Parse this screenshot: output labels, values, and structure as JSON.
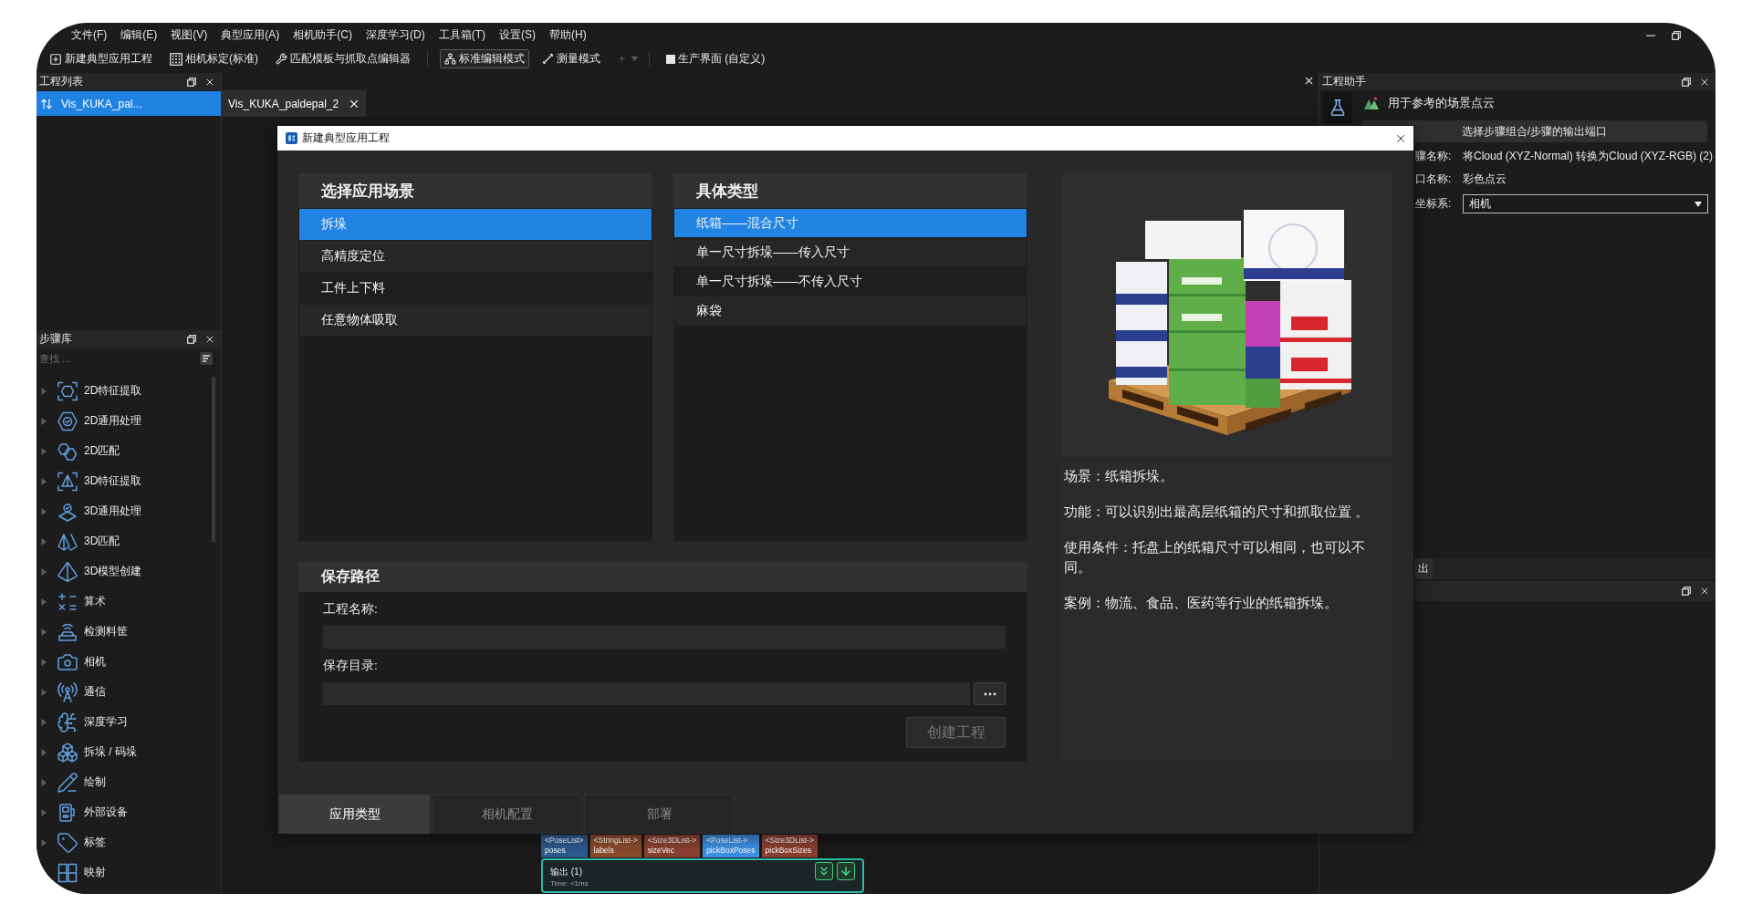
{
  "menubar": {
    "items": [
      "文件(F)",
      "编辑(E)",
      "视图(V)",
      "典型应用(A)",
      "相机助手(C)",
      "深度学习(D)",
      "工具箱(T)",
      "设置(S)",
      "帮助(H)"
    ]
  },
  "toolbar": {
    "actions": [
      {
        "label": "新建典型应用工程"
      },
      {
        "label": "相机标定(标准)"
      },
      {
        "label": "匹配模板与抓取点编辑器"
      }
    ],
    "modes": [
      {
        "label": "标准编辑模式",
        "selected": true
      },
      {
        "label": "测量模式",
        "selected": false
      }
    ],
    "add_menu": {
      "disabled": true
    },
    "views": [
      {
        "label": "生产界面 (自定义)"
      }
    ]
  },
  "project_list": {
    "title": "工程列表",
    "items": [
      {
        "label": "Vis_KUKA_pal...",
        "selected": true
      }
    ]
  },
  "step_library": {
    "title": "步骤库",
    "search": {
      "placeholder": "查找 ..."
    },
    "items": [
      {
        "label": "2D特征提取",
        "expanded": false
      },
      {
        "label": "2D通用处理",
        "expanded": false
      },
      {
        "label": "2D匹配",
        "expanded": false
      },
      {
        "label": "3D特征提取",
        "expanded": false
      },
      {
        "label": "3D通用处理",
        "expanded": false
      },
      {
        "label": "3D匹配",
        "expanded": false
      },
      {
        "label": "3D模型创建",
        "expanded": false
      },
      {
        "label": "算术",
        "expanded": false
      },
      {
        "label": "检测料筐",
        "expanded": false
      },
      {
        "label": "相机",
        "expanded": false
      },
      {
        "label": "通信",
        "expanded": false
      },
      {
        "label": "深度学习",
        "expanded": false
      },
      {
        "label": "拆垛 / 码垛",
        "expanded": false
      },
      {
        "label": "绘制",
        "expanded": false
      },
      {
        "label": "外部设备",
        "expanded": false
      },
      {
        "label": "标签",
        "expanded": false
      },
      {
        "label": "映射",
        "expanded": false
      }
    ]
  },
  "editor": {
    "tabs": [
      {
        "label": "Vis_KUKA_paldepal_2",
        "selected": true
      }
    ],
    "node": {
      "ports": [
        {
          "type": "<PoseList>",
          "name": "poses",
          "color": "#2d5b8e"
        },
        {
          "type": "<StringList->",
          "name": "labels",
          "color": "#8c4b2c"
        },
        {
          "type": "<Size3DList->",
          "name": "sizeVec",
          "color": "#8b4031"
        },
        {
          "type": "<PoseList->",
          "name": "pickBoxPoses",
          "color": "#3d90e2"
        },
        {
          "type": "<Size3DList->",
          "name": "pickBoxSizes",
          "color": "#8b4031"
        }
      ],
      "title": "输出 (1)",
      "time": "Time: <1ms"
    }
  },
  "project_assistant": {
    "title": "工程助手",
    "scene": "用于参考的场景点云",
    "output_button": "选择步骤组合/步骤的输出端口",
    "fields": [
      {
        "label": "骤名称:",
        "value": "将Cloud (XYZ-Normal) 转换为Cloud (XYZ-RGB) (2)"
      },
      {
        "label": "口名称:",
        "value": "彩色点云"
      }
    ],
    "coordinate": {
      "label": "坐标系:",
      "value": "相机"
    },
    "output_tab": "出"
  },
  "dialog": {
    "title": "新建典型应用工程",
    "scenarios": {
      "title": "选择应用场景",
      "items": [
        {
          "label": "拆垛",
          "selected": true
        },
        {
          "label": "高精度定位",
          "selected": false
        },
        {
          "label": "工件上下料",
          "selected": false
        },
        {
          "label": "任意物体吸取",
          "selected": false
        }
      ]
    },
    "types": {
      "title": "具体类型",
      "items": [
        {
          "label": "纸箱——混合尺寸",
          "selected": true
        },
        {
          "label": "单一尺寸拆垛——传入尺寸",
          "selected": false
        },
        {
          "label": "单一尺寸拆垛——不传入尺寸",
          "selected": false
        },
        {
          "label": "麻袋",
          "selected": false
        }
      ]
    },
    "save": {
      "title": "保存路径",
      "fields": [
        {
          "label": "工程名称:",
          "kind": "text"
        },
        {
          "label": "保存目录:",
          "kind": "browse"
        }
      ],
      "create_button": {
        "label": "创建工程",
        "disabled": true
      }
    },
    "description": [
      "场景：纸箱拆垛。",
      "功能：可以识别出最高层纸箱的尺寸和抓取位置 。",
      "使用条件：托盘上的纸箱尺寸可以相同，也可以不同。",
      "案例：物流、食品、医药等行业的纸箱拆垛。"
    ],
    "tabs": [
      {
        "label": "应用类型",
        "selected": true
      },
      {
        "label": "相机配置",
        "selected": false
      },
      {
        "label": "部署",
        "selected": false
      }
    ]
  }
}
